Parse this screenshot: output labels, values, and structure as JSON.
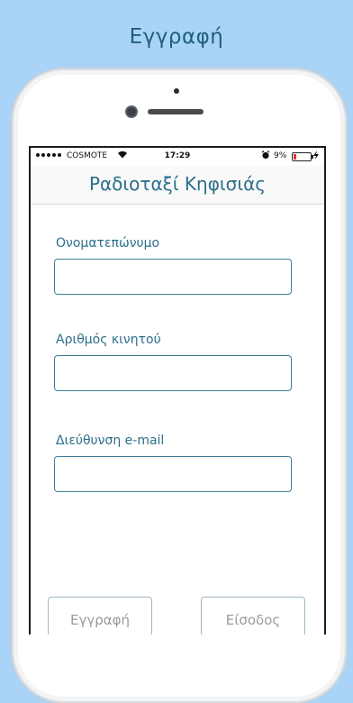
{
  "promo": {
    "title": "Εγγραφή"
  },
  "status_bar": {
    "carrier": "COSMOTE",
    "time": "17:29",
    "battery": "9%",
    "battery_level": 0.09
  },
  "nav": {
    "title": "Ραδιοταξί Κηφισιάς"
  },
  "form": {
    "fields": [
      {
        "label": "Ονοματεπώνυμο",
        "value": ""
      },
      {
        "label": "Αριθμός κινητού",
        "value": ""
      },
      {
        "label": "Διεύθυνση e-mail",
        "value": ""
      }
    ]
  },
  "buttons": {
    "register": "Εγγραφή",
    "login": "Είσοδος"
  },
  "colors": {
    "background": "#a9d4f7",
    "accent": "#2b6f8c",
    "battery_low": "#e0322f"
  }
}
